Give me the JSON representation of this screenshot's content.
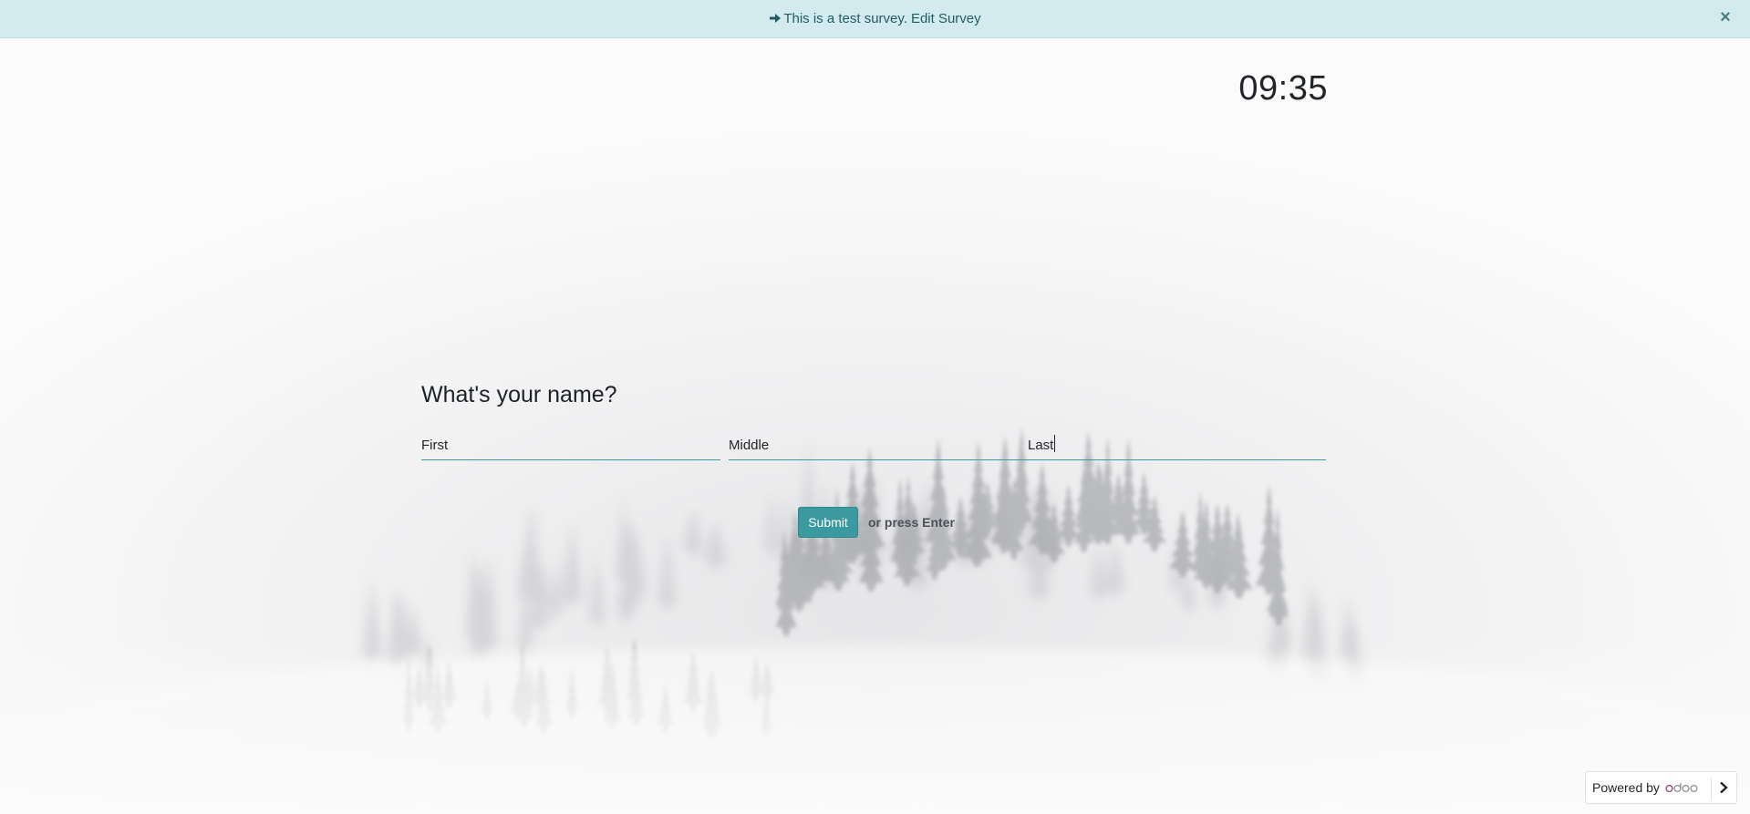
{
  "banner": {
    "icon": "arrow-right-icon",
    "message": "This is a test survey.",
    "link_label": "Edit Survey",
    "close_icon": "close-icon",
    "close_glyph": "×",
    "background": "#d3eaee",
    "text_color": "#1f5d66"
  },
  "timer": {
    "value": "09:35"
  },
  "question": {
    "title": "What's your name?",
    "fields": [
      {
        "placeholder": "First",
        "value": ""
      },
      {
        "placeholder": "Middle",
        "value": ""
      },
      {
        "placeholder": "Last",
        "value": ""
      }
    ]
  },
  "submit": {
    "label": "Submit",
    "hint": "or press Enter",
    "color": "#3a9a9f"
  },
  "footer": {
    "powered_by": "Powered by",
    "logo_text": "odoo",
    "toggle_icon": "chevron-right-icon"
  }
}
